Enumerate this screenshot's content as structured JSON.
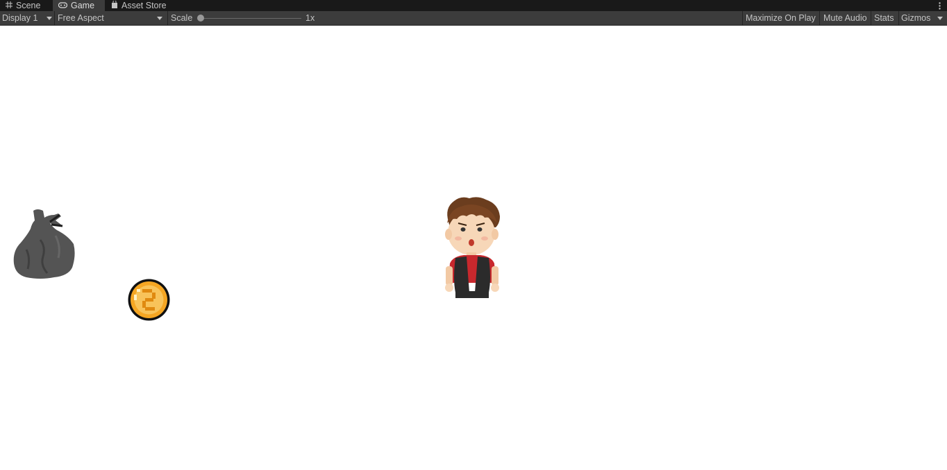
{
  "tabs": [
    {
      "label": "Scene",
      "icon": "grid-icon"
    },
    {
      "label": "Game",
      "icon": "gamepad-icon"
    },
    {
      "label": "Asset Store",
      "icon": "store-bag-icon"
    }
  ],
  "active_tab": "Game",
  "toolbar": {
    "display": "Display 1",
    "aspect": "Free Aspect",
    "scale_label": "Scale",
    "scale_value": "1x",
    "maximize": "Maximize On Play",
    "mute": "Mute Audio",
    "stats": "Stats",
    "gizmos": "Gizmos"
  },
  "colors": {
    "tab_bar": "#191919",
    "toolbar": "#3c3c3c",
    "text": "#c4c4c4",
    "game_background": "#ffffff",
    "coin": "#f5a623"
  },
  "sprites": [
    "trash-bag-sprite",
    "coin-sprite",
    "player-character-sprite"
  ]
}
